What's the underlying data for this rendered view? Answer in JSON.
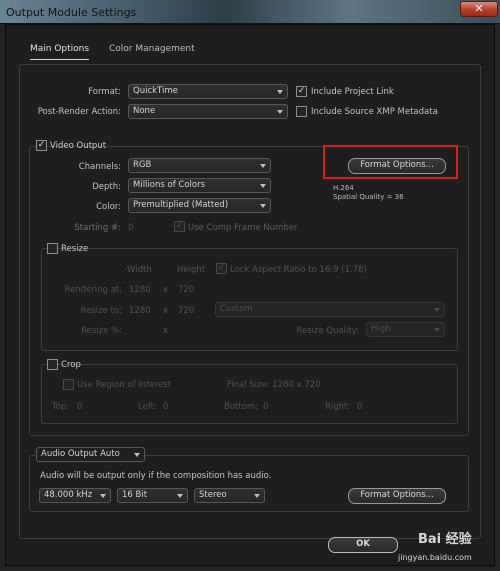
{
  "window": {
    "title": "Output Module Settings",
    "close_glyph": "✕"
  },
  "tabs": [
    {
      "label": "Main Options"
    },
    {
      "label": "Color Management"
    }
  ],
  "main": {
    "format_label": "Format:",
    "format_value": "QuickTime",
    "include_project_link_label": "Include Project Link",
    "include_project_link_checked": true,
    "post_render_label": "Post-Render Action:",
    "post_render_value": "None",
    "include_xmp_label": "Include Source XMP Metadata",
    "include_xmp_checked": false
  },
  "video": {
    "section_label": "Video Output",
    "checked": true,
    "channels_label": "Channels:",
    "channels_value": "RGB",
    "depth_label": "Depth:",
    "depth_value": "Millions of Colors",
    "color_label": "Color:",
    "color_value": "Premultiplied (Matted)",
    "starting_label": "Starting #:",
    "starting_value": "0",
    "use_comp_frame_label": "Use Comp Frame Number",
    "format_options_button": "Format Options...",
    "codec_info": "H.264",
    "quality_info": "Spatial Quality = 36"
  },
  "resize": {
    "section_label": "Resize",
    "width_header": "Width",
    "height_header": "Height",
    "lock_aspect_label": "Lock Aspect Ratio to 16:9 (1.78)",
    "rendering_at_label": "Rendering at:",
    "rendering_w": "1280",
    "rendering_h": "720",
    "resize_to_label": "Resize to:",
    "resize_to_w": "1280",
    "resize_to_h": "720",
    "preset_value": "Custom",
    "resize_pct_label": "Resize %:",
    "times": "x",
    "quality_label": "Resize Quality:",
    "quality_value": "High"
  },
  "crop": {
    "section_label": "Crop",
    "roi_label": "Use Region of Interest",
    "final_size": "Final Size: 1280 x 720",
    "top_label": "Top:",
    "top_value": "0",
    "left_label": "Left:",
    "left_value": "0",
    "bottom_label": "Bottom:",
    "bottom_value": "0",
    "right_label": "Right:",
    "right_value": "0"
  },
  "audio": {
    "mode_value": "Audio Output Auto",
    "note": "Audio will be output only if the composition has audio.",
    "rate_value": "48.000 kHz",
    "bits_value": "16 Bit",
    "channels_value": "Stereo",
    "format_options_button": "Format Options..."
  },
  "footer": {
    "ok_button": "OK"
  },
  "watermark": {
    "brand": "Bai 经验",
    "url": "jingyan.baidu.com"
  },
  "colors": {
    "highlight": "#d62020",
    "background": "#1e1e1e"
  }
}
